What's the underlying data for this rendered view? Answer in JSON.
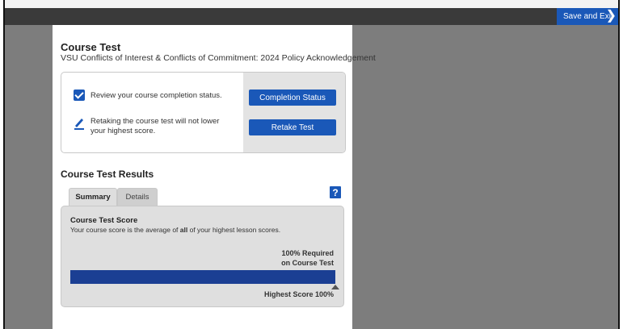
{
  "header": {
    "save_exit_label": "Save and Exit",
    "chevron_icon": "chevron-right-icon"
  },
  "course": {
    "title": "Course Test",
    "subtitle": "VSU Conflicts of Interest & Conflicts of Commitment: 2024 Policy Acknowledgement"
  },
  "status": {
    "review_text": "Review your course completion status.",
    "retake_text": "Retaking the course test will not lower your highest score.",
    "completion_button": "Completion Status",
    "retake_button": "Retake Test",
    "icons": [
      "checkbox-icon",
      "pencil-icon"
    ]
  },
  "results": {
    "title": "Course Test Results",
    "help_label": "?",
    "tabs": [
      {
        "label": "Summary",
        "active": true
      },
      {
        "label": "Details",
        "active": false
      }
    ],
    "score_title": "Course Test Score",
    "score_desc_prefix": "Your course score is the average of",
    "score_desc_bold": "all",
    "score_desc_suffix": "of your highest lesson scores.",
    "required_line1": "100% Required",
    "required_line2": "on Course Test",
    "highest_score_label": "Highest Score 100%",
    "score_percent": 100
  },
  "colors": {
    "accent": "#1a58b8",
    "bar": "#1b3f93",
    "topbar": "#3a3a3a",
    "backdrop": "#7d7d7d"
  }
}
